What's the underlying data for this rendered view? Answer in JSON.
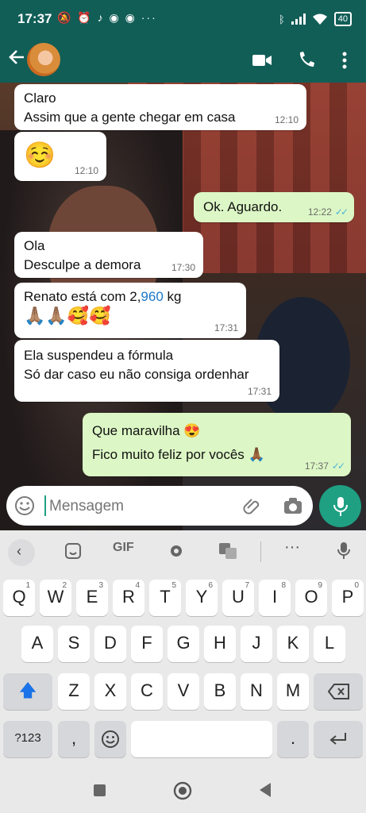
{
  "status_bar": {
    "time": "17:37",
    "battery": "40",
    "left_icons": [
      "mute-icon",
      "alarm-icon",
      "tiktok-icon",
      "chrome-icon",
      "chrome-icon",
      "more-dots-icon"
    ],
    "right_icons": [
      "bluetooth-icon",
      "signal-icon",
      "wifi-icon",
      "battery-icon"
    ]
  },
  "app_bar": {
    "icons": [
      "back-arrow-icon",
      "avatar",
      "video-call-icon",
      "phone-icon",
      "more-vert-icon"
    ]
  },
  "messages": [
    {
      "dir": "in",
      "text": "Claro\nAssim que a gente chegar em casa",
      "time": "12:10"
    },
    {
      "dir": "in",
      "text": "☺️",
      "time": "12:10"
    },
    {
      "dir": "out",
      "text": "Ok. Aguardo.",
      "time": "12:22",
      "read": true
    },
    {
      "dir": "in",
      "text": "Ola\nDesculpe a demora",
      "time": "17:30"
    },
    {
      "dir": "in",
      "text_prefix": "Renato está com 2,",
      "text_highlight": "960",
      "text_suffix": " kg",
      "line2": "🙏🏽🙏🏽🥰🥰",
      "time": "17:31"
    },
    {
      "dir": "in",
      "text": "Ela suspendeu a fórmula\nSó dar caso eu não consiga ordenhar",
      "time": "17:31"
    },
    {
      "dir": "out",
      "text": "Que maravilha 😍\nFico muito feliz por vocês 🙏🏾",
      "time": "17:37",
      "read": true
    }
  ],
  "composer": {
    "placeholder": "Mensagem",
    "icons": [
      "emoji-icon",
      "attach-icon",
      "camera-icon",
      "mic-icon"
    ]
  },
  "keyboard": {
    "toolbar": [
      "back-chevron-icon",
      "sticker-icon",
      "GIF",
      "settings-icon",
      "translate-icon",
      "more-dots-icon",
      "mic-icon"
    ],
    "gif_label": "GIF",
    "row1": [
      [
        "Q",
        "1"
      ],
      [
        "W",
        "2"
      ],
      [
        "E",
        "3"
      ],
      [
        "R",
        "4"
      ],
      [
        "T",
        "5"
      ],
      [
        "Y",
        "6"
      ],
      [
        "U",
        "7"
      ],
      [
        "I",
        "8"
      ],
      [
        "O",
        "9"
      ],
      [
        "P",
        "0"
      ]
    ],
    "row2": [
      "A",
      "S",
      "D",
      "F",
      "G",
      "H",
      "J",
      "K",
      "L"
    ],
    "row3": [
      "Z",
      "X",
      "C",
      "V",
      "B",
      "N",
      "M"
    ],
    "sym_label": "?123",
    "comma": ",",
    "period": "."
  },
  "nav_bar": [
    "recents-icon",
    "home-icon",
    "back-icon"
  ],
  "colors": {
    "header": "#115e57",
    "outgoing": "#dcf7c5",
    "incoming": "#ffffff",
    "accent": "#1fa083"
  }
}
